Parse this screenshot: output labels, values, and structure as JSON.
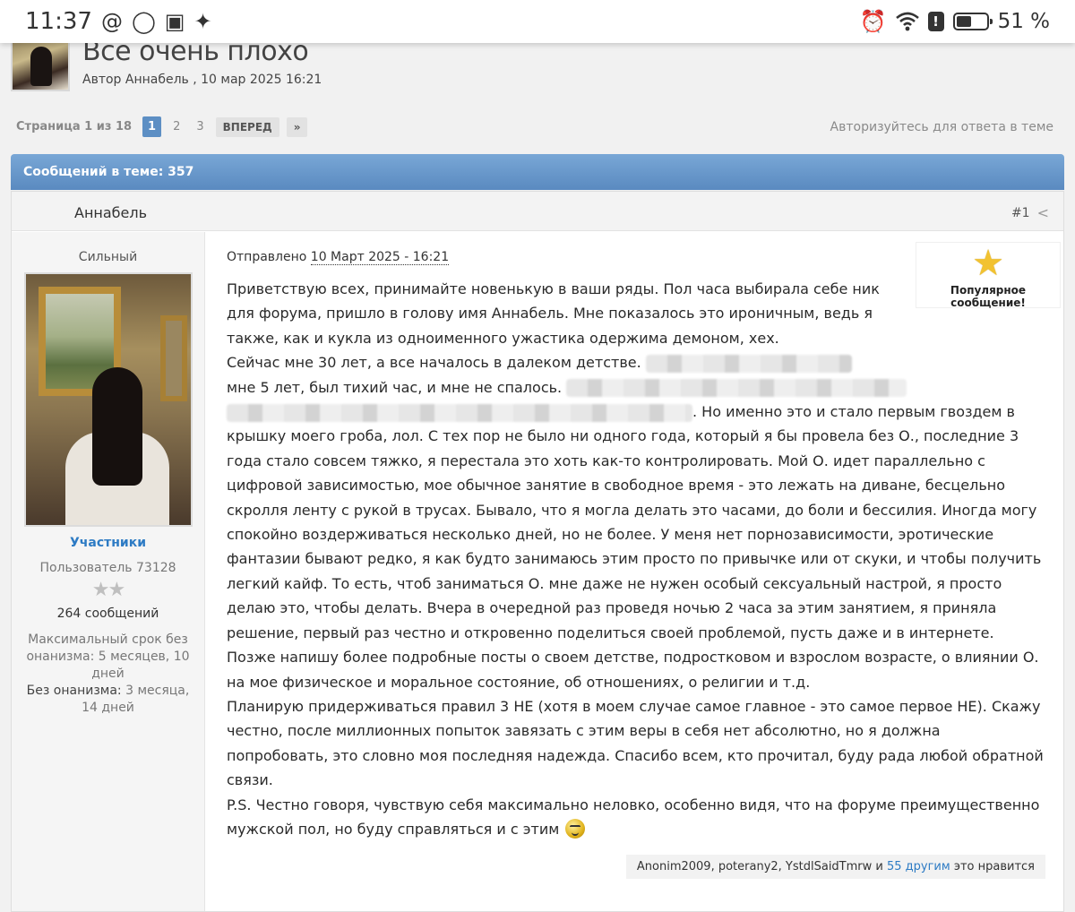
{
  "statusbar": {
    "time": "11:37",
    "battery_percent": "51 %",
    "battery_level": 0.51
  },
  "topic": {
    "title": "Все очень плохо",
    "meta": "Автор Аннабель , 10 мар 2025 16:21"
  },
  "pagination": {
    "label": "Страница 1 из 18",
    "pages": [
      "1",
      "2",
      "3"
    ],
    "active_page": "1",
    "next_label": "ВПЕРЕД",
    "last_label": "»",
    "login_prompt": "Авторизуйтесь для ответа в теме"
  },
  "posts_bar": {
    "label": "Сообщений в теме: 357"
  },
  "post": {
    "author": "Аннабель",
    "number": "#1",
    "sidebar": {
      "rank": "Сильный",
      "group": "Участники",
      "user_id": "Пользователь 73128",
      "stars": "★★",
      "message_count": "264 сообщений",
      "max_term_label": "Максимальный срок без онанизма:",
      "max_term_value": "5 месяцев, 10 дней",
      "without_label": "Без онанизма:",
      "without_value": "3 месяца, 14 дней"
    },
    "sent_label": "Отправлено",
    "sent_date": "10 Март 2025 - 16:21",
    "popular_label": "Популярное сообщение!",
    "paragraphs": {
      "p1": "Приветствую всех, принимайте новенькую в ваши ряды. Пол часа выбирала себе ник для форума, пришло в голову имя Аннабель. Мне показалось это ироничным, ведь я также, как и кукла из одноименного ужастика одержима демоном, хех.",
      "p2_start": "Сейчас мне 30 лет, а все началось в далеком детстве.",
      "p2_mid_visible": "мне 5 лет, был тихий час, и мне не спалось.",
      "p2_end": ". Но именно это и стало первым гвоздем в крышку моего гроба, лол. С тех пор не было ни одного года, который я бы провела без О., последние 3 года стало совсем тяжко, я перестала это хоть как-то контролировать. Мой О. идет параллельно с цифровой зависимостью, мое обычное занятие в свободное время - это лежать на диване, бесцельно скролля ленту с рукой в трусах. Бывало, что я могла делать это часами, до боли и бессилия. Иногда могу спокойно воздерживаться несколько дней, но не более. У меня нет порнозависимости, эротические фантазии бывают редко, я как будто занимаюсь этим просто по привычке или от скуки, и чтобы получить легкий кайф. То есть, чтоб заниматься О. мне даже не нужен особый сексуальный настрой, я просто делаю это, чтобы делать. Вчера в очередной раз проведя ночью 2 часа за этим занятием, я приняла решение, первый раз честно и откровенно поделиться своей проблемой, пусть даже и в интернете. Позже напишу более подробные посты о своем детстве, подростковом и взрослом возрасте, о влиянии О. на мое физическое и моральное состояние, об отношениях, о религии и т.д.",
      "p3": "Планирую придерживаться правил 3 НЕ (хотя в моем случае самое главное - это самое первое НЕ). Скажу честно, после миллионных попыток завязать с этим веры в себя нет абсолютно, но я должна попробовать, это словно моя последняя надежда. Спасибо всем, кто прочитал, буду рада любой обратной связи.",
      "p4": "P.S. Честно говоря, чувствую себя максимально неловко, особенно видя, что на форуме преимущественно мужской пол, но буду справляться и с этим"
    },
    "likes": {
      "names": "Anonim2009, poterany2, YstdlSaidTmrw и",
      "others": "55 другим",
      "suffix": "это нравится"
    }
  }
}
